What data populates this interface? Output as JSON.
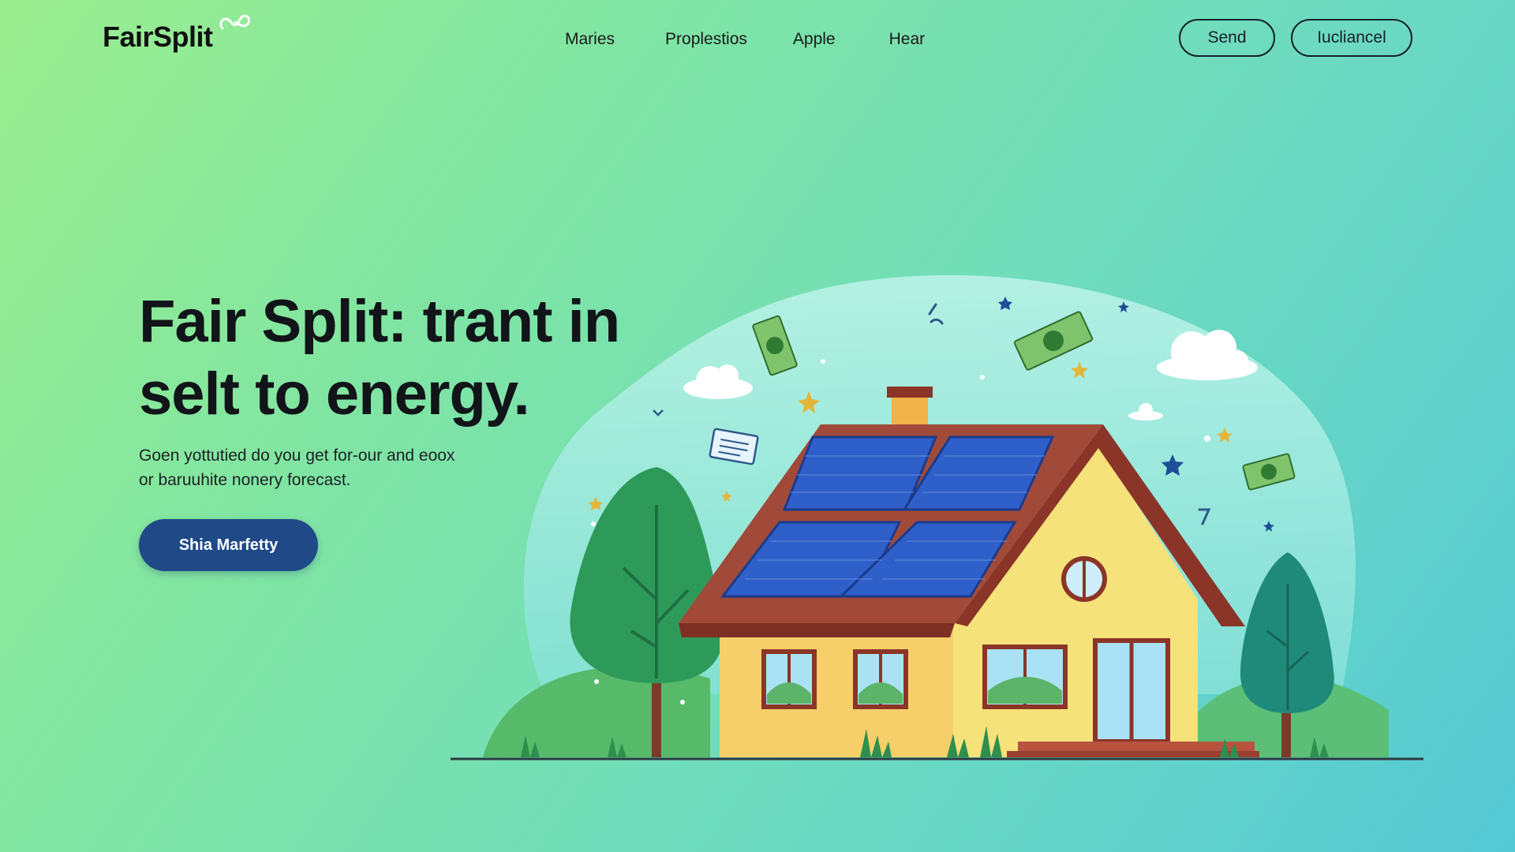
{
  "brand": {
    "name": "FairSplit"
  },
  "nav": {
    "links": [
      "Maries",
      "Proplestios",
      "Apple",
      "Hear"
    ],
    "send_label": "Send",
    "cancel_label": "Ιucliancel"
  },
  "hero": {
    "title_line1": "Fair Split: trant in",
    "title_line2": "selt to energy.",
    "subtitle_line1": "Goen yottutied do you get for-our and eoox",
    "subtitle_line2": "or baruuhite nonery forecast.",
    "cta_label": "Shia Marfetty"
  },
  "colors": {
    "cta_background": "#1f4a87",
    "background_start": "#9bee8e",
    "background_end": "#55c9d6"
  },
  "icons": {
    "logo_mark": "infinity-loop-icon",
    "illustration": "solar-house-illustration"
  }
}
